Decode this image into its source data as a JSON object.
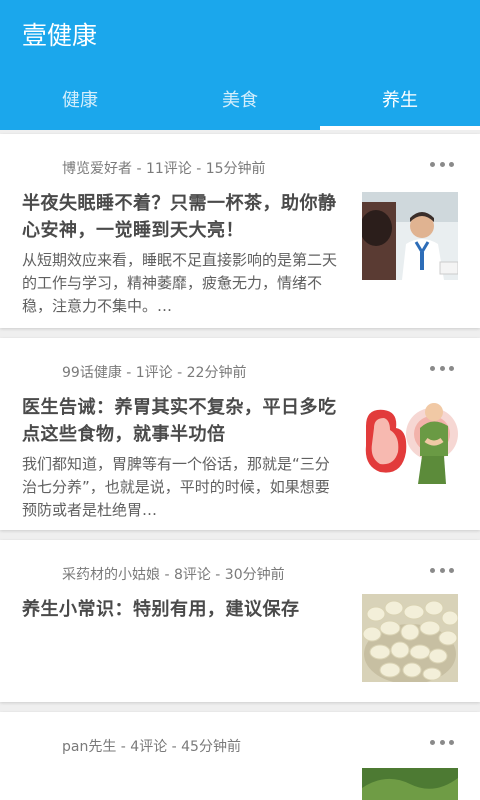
{
  "app": {
    "title": "壹健康"
  },
  "tabs": [
    {
      "label": "健康",
      "active": false
    },
    {
      "label": "美食",
      "active": false
    },
    {
      "label": "养生",
      "active": true
    }
  ],
  "articles": [
    {
      "meta": "博览爱好者 - 11评论 - 15分钟前",
      "title": "半夜失眠睡不着？只需一杯茶，助你静心安神，一觉睡到天大亮！",
      "summary": "从短期效应来看，睡眠不足直接影响的是第二天的工作与学习，精神萎靡，疲惫无力，情绪不稳，注意力不集中。…",
      "thumb": "doctor-photo"
    },
    {
      "meta": "99话健康 - 1评论 - 22分钟前",
      "title": "医生告诫：养胃其实不复杂，平日多吃点这些食物，就事半功倍",
      "summary": "我们都知道，胃脾等有一个俗话，那就是“三分治七分养”，也就是说，平时的时候，如果想要预防或者是杜绝胃…",
      "thumb": "stomach-illustration"
    },
    {
      "meta": "采药材的小姑娘 - 8评论 - 30分钟前",
      "title": "养生小常识：特别有用，建议保存",
      "summary": "",
      "thumb": "garlic-photo"
    },
    {
      "meta": "pan先生 - 4评论 - 45分钟前",
      "title": "",
      "summary": "",
      "thumb": "greens-photo"
    }
  ],
  "colors": {
    "header": "#1ba7ec",
    "background": "#efefef"
  },
  "icons": {
    "more": "more-dots-icon"
  }
}
